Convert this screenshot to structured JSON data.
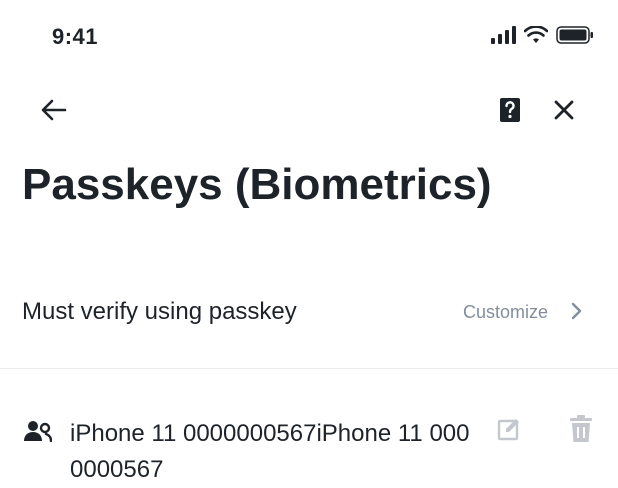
{
  "status_bar": {
    "time": "9:41",
    "icons": [
      "signal-icon",
      "wifi-icon",
      "battery-icon"
    ]
  },
  "nav": {
    "icons": [
      "back-arrow-icon",
      "help-doc-icon",
      "close-icon"
    ]
  },
  "page": {
    "title": "Passkeys (Biometrics)"
  },
  "verify_row": {
    "label": "Must verify using passkey",
    "action_label": "Customize",
    "icon": "chevron-right-icon"
  },
  "devices": [
    {
      "name": "iPhone 11 0000000567iPhone 11 0000000567",
      "icon": "users-icon",
      "actions": [
        "edit-icon",
        "trash-icon"
      ]
    }
  ],
  "colors": {
    "text_primary": "#1e2329",
    "text_secondary": "#848e9c",
    "icon_muted": "#c4c8ce",
    "divider": "#eaecef"
  }
}
